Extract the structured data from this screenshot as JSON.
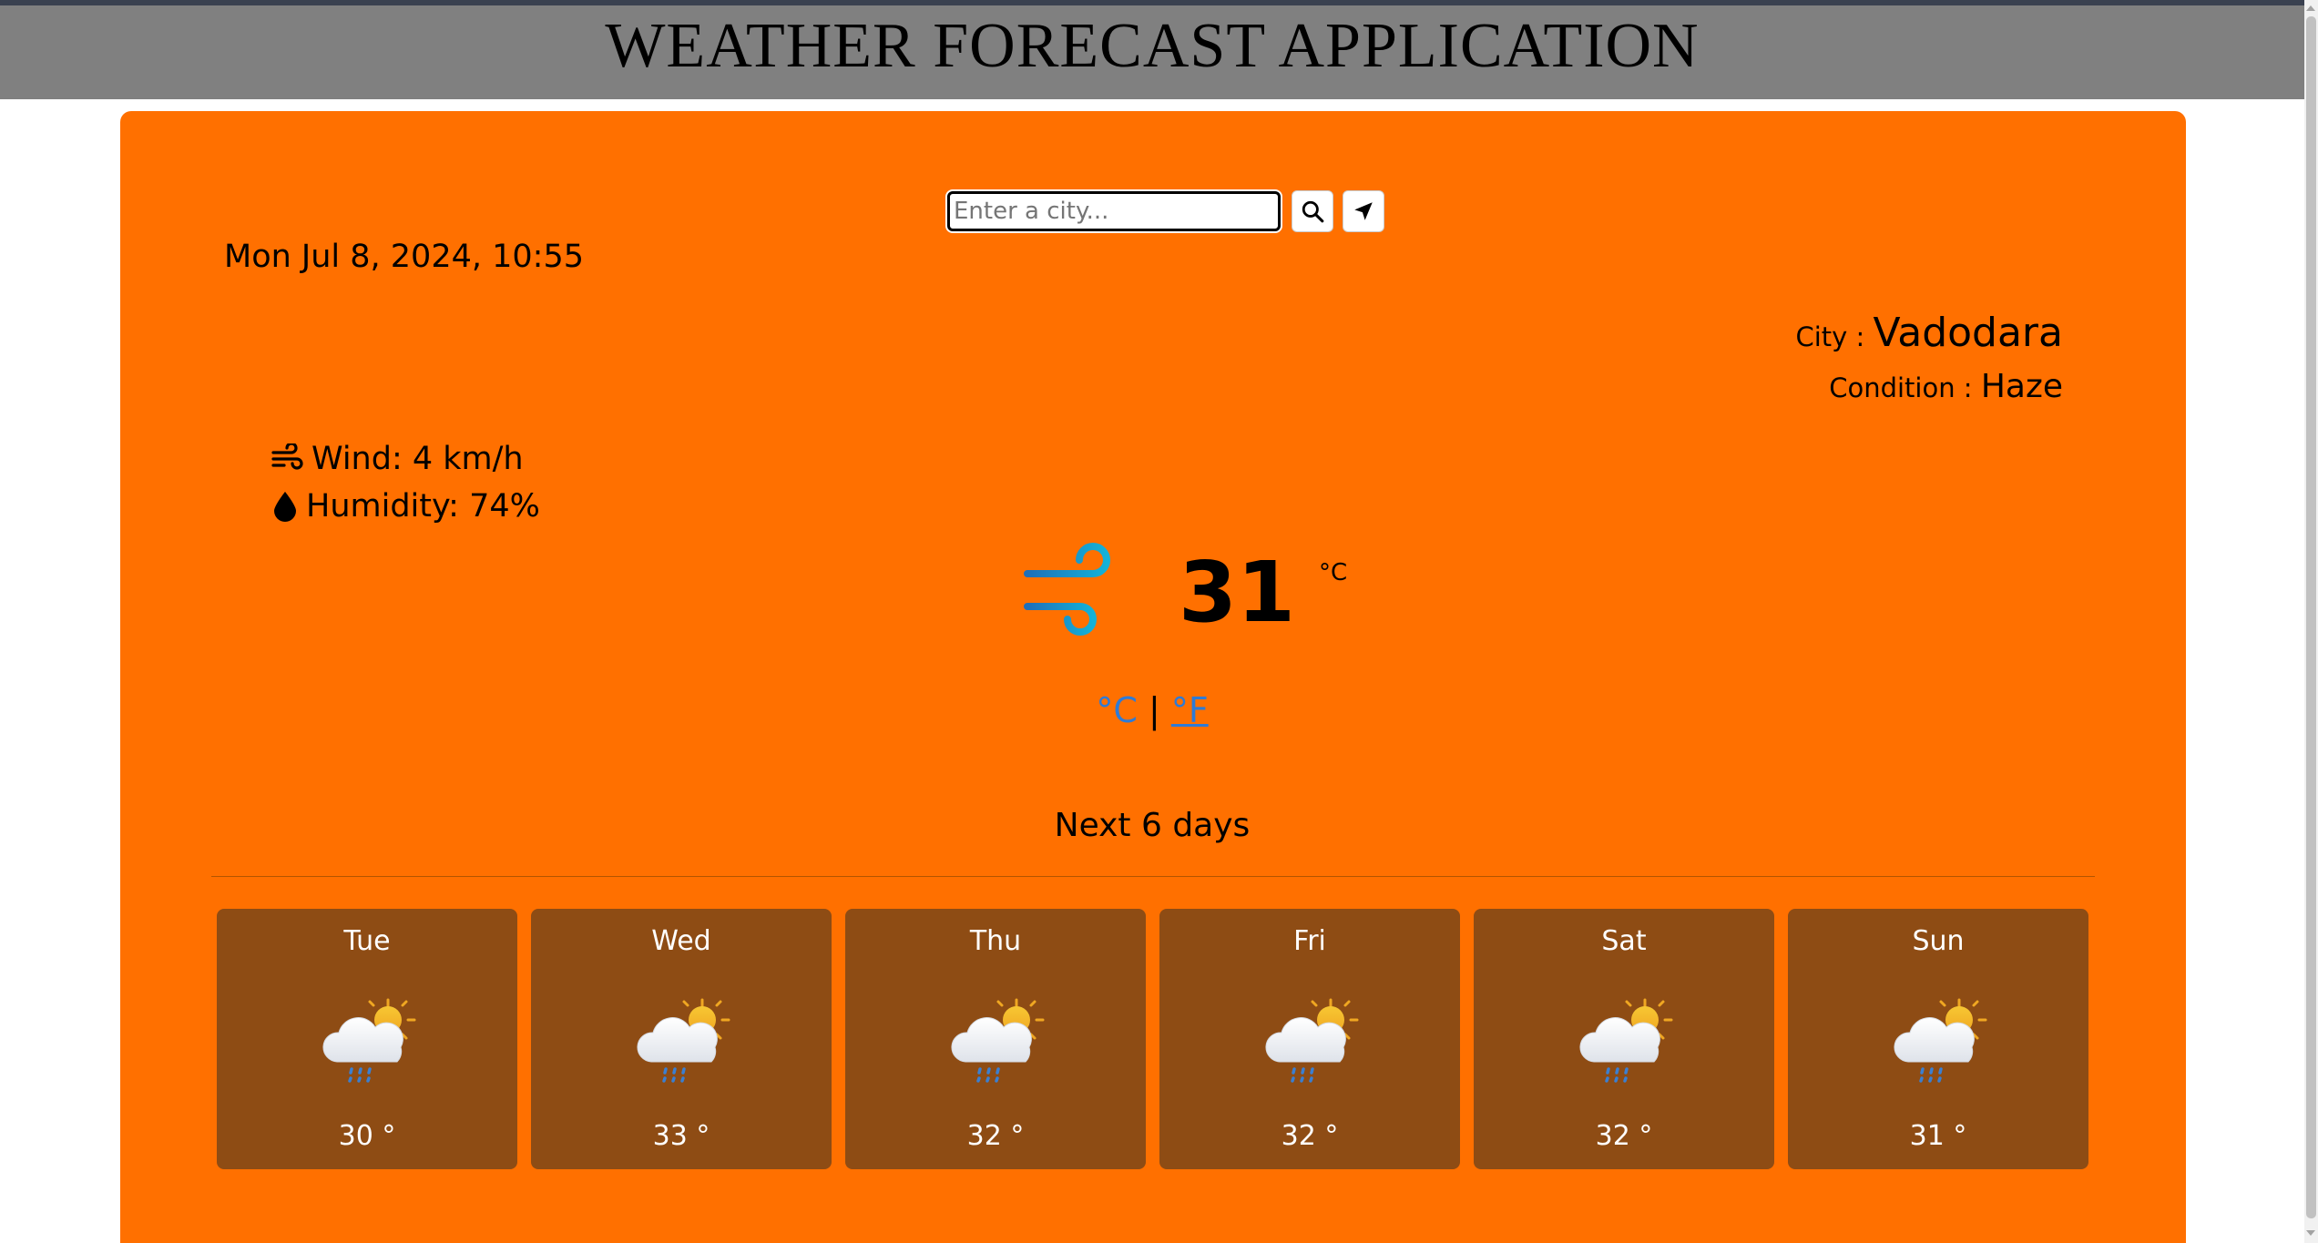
{
  "app": {
    "title": "WEATHER FORECAST APPLICATION"
  },
  "search": {
    "placeholder": "Enter a city...",
    "value": ""
  },
  "current": {
    "datetime": "Mon Jul 8, 2024, 10:55",
    "city_label": "City : ",
    "city": "Vadodara",
    "condition_label": "Condition : ",
    "condition": "Haze",
    "wind": "Wind: 4 km/h",
    "humidity": "Humidity: 74%",
    "temperature": "31",
    "temperature_unit": "°C",
    "icon": "wind-icon"
  },
  "unit_toggle": {
    "celsius": "°C",
    "separator": " | ",
    "fahrenheit": "°F"
  },
  "forecast": {
    "heading": "Next 6 days",
    "days": [
      {
        "day": "Tue",
        "temp": "30 °",
        "icon": "partly-cloudy-rain-icon"
      },
      {
        "day": "Wed",
        "temp": "33 °",
        "icon": "partly-cloudy-rain-icon"
      },
      {
        "day": "Thu",
        "temp": "32 °",
        "icon": "partly-cloudy-rain-icon"
      },
      {
        "day": "Fri",
        "temp": "32 °",
        "icon": "partly-cloudy-rain-icon"
      },
      {
        "day": "Sat",
        "temp": "32 °",
        "icon": "partly-cloudy-rain-icon"
      },
      {
        "day": "Sun",
        "temp": "31 °",
        "icon": "partly-cloudy-rain-icon"
      }
    ]
  },
  "colors": {
    "header_bg": "#808080",
    "card_bg": "#ff7000",
    "forecast_card_bg": "#8e4c14",
    "link": "#2e7bd6"
  }
}
